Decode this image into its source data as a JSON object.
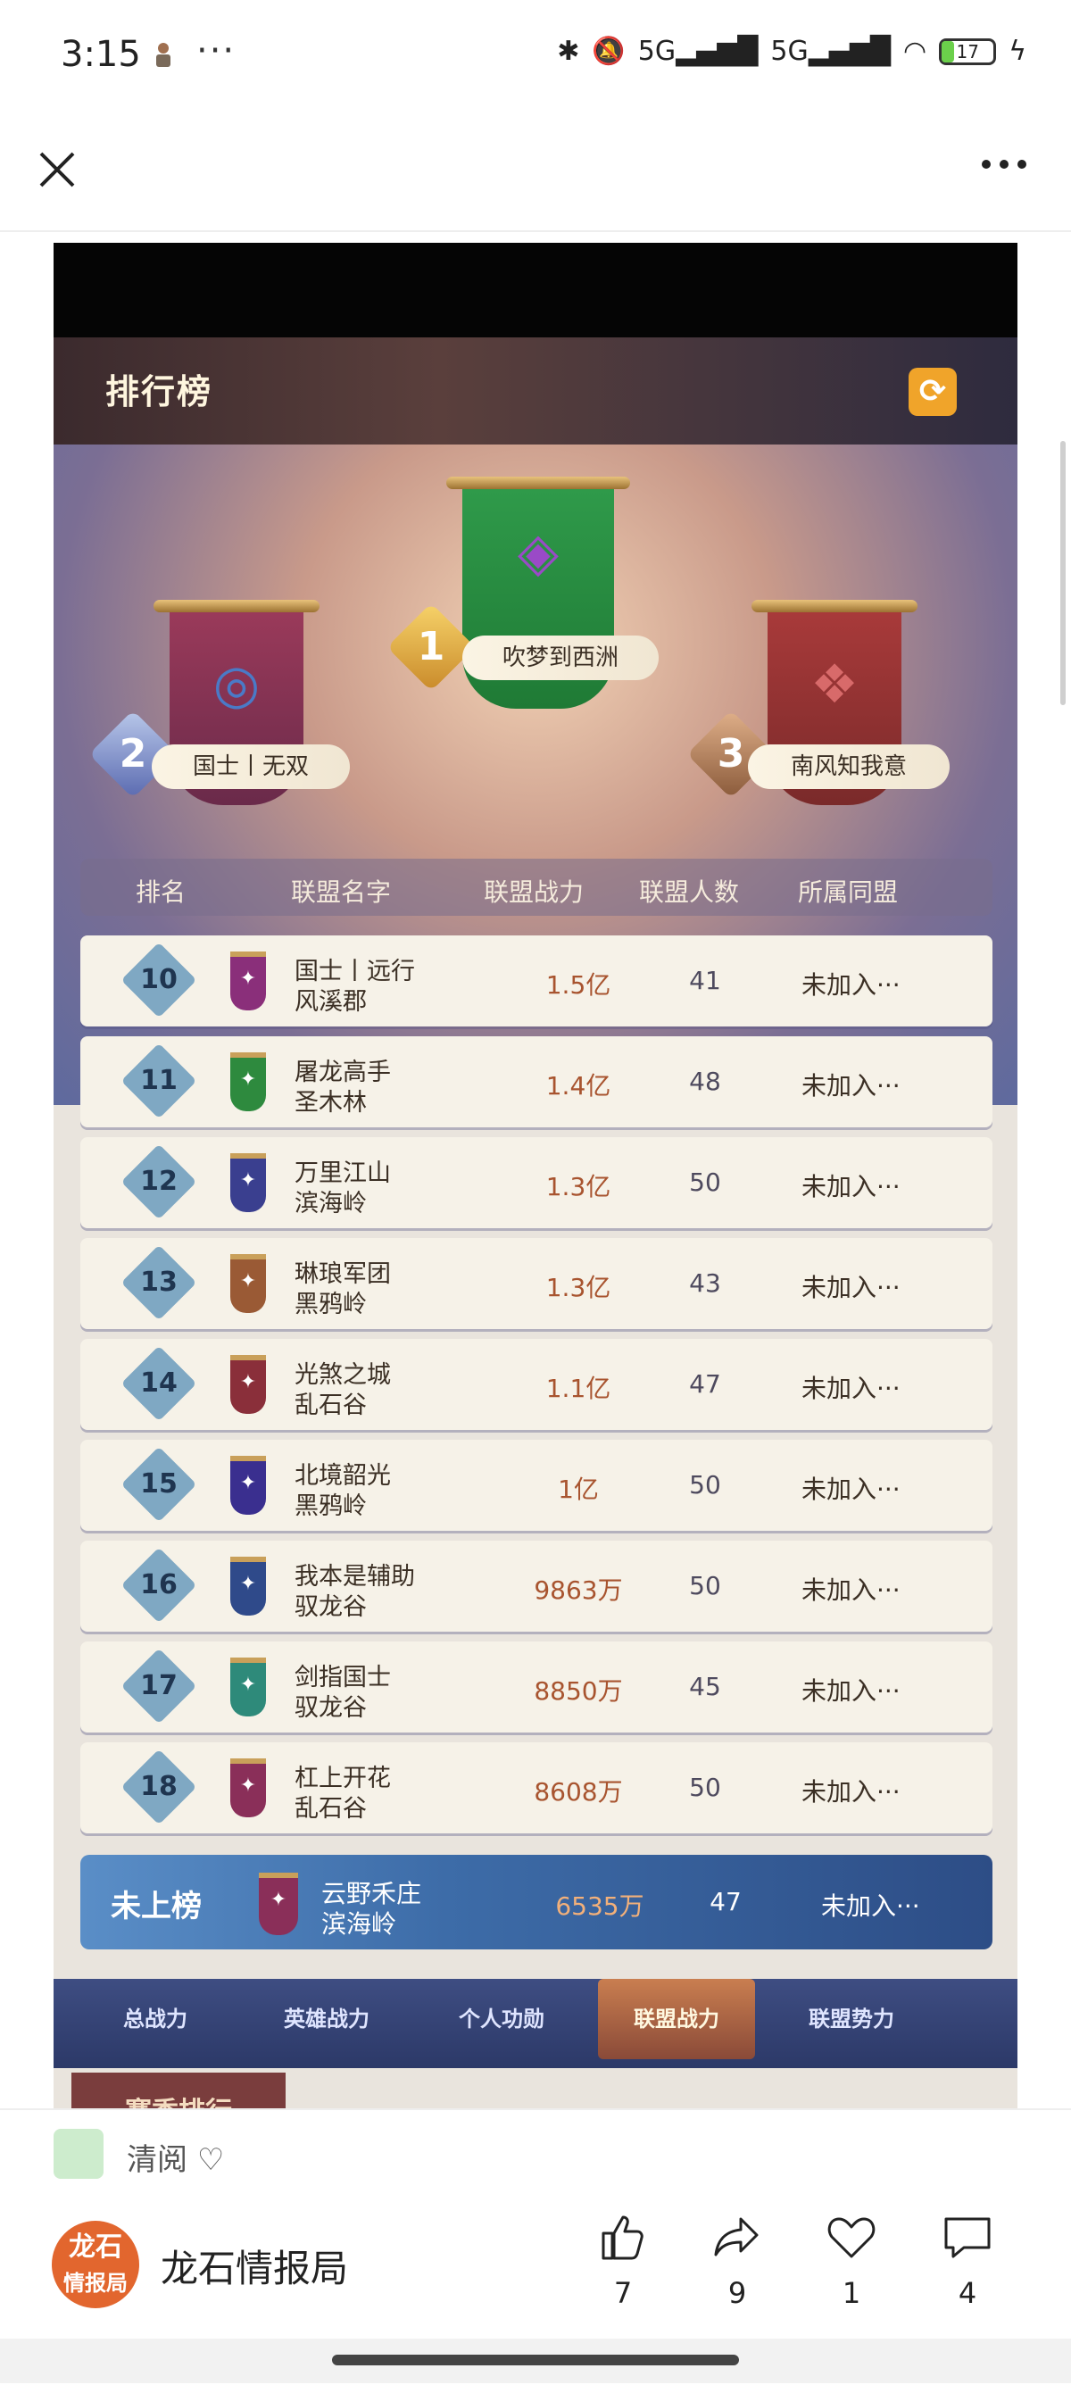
{
  "status": {
    "time": "3:15",
    "dots": "···",
    "network1": "5G",
    "network2": "5G",
    "battery": "17"
  },
  "game": {
    "title": "排行榜",
    "podium": [
      {
        "rank": "1",
        "name": "吹梦到西洲"
      },
      {
        "rank": "2",
        "name": "国士丨无双"
      },
      {
        "rank": "3",
        "name": "南风知我意"
      }
    ],
    "columns": [
      "排名",
      "联盟名字",
      "联盟战力",
      "联盟人数",
      "所属同盟"
    ],
    "rows": [
      {
        "rank": "10",
        "name": "国士丨远行",
        "region": "风溪郡",
        "power": "1.5亿",
        "members": "41",
        "alliance": "未加入···",
        "flag_color": "#8a2f7a"
      },
      {
        "rank": "11",
        "name": "屠龙高手",
        "region": "圣木林",
        "power": "1.4亿",
        "members": "48",
        "alliance": "未加入···",
        "flag_color": "#2e8a3e"
      },
      {
        "rank": "12",
        "name": "万里江山",
        "region": "滨海岭",
        "power": "1.3亿",
        "members": "50",
        "alliance": "未加入···",
        "flag_color": "#3a3f8f"
      },
      {
        "rank": "13",
        "name": "琳琅军团",
        "region": "黑鸦岭",
        "power": "1.3亿",
        "members": "43",
        "alliance": "未加入···",
        "flag_color": "#9a5a35"
      },
      {
        "rank": "14",
        "name": "光煞之城",
        "region": "乱石谷",
        "power": "1.1亿",
        "members": "47",
        "alliance": "未加入···",
        "flag_color": "#8a2f3a"
      },
      {
        "rank": "15",
        "name": "北境韶光",
        "region": "黑鸦岭",
        "power": "1亿",
        "members": "50",
        "alliance": "未加入···",
        "flag_color": "#3a2f8f"
      },
      {
        "rank": "16",
        "name": "我本是辅助",
        "region": "驭龙谷",
        "power": "9863万",
        "members": "50",
        "alliance": "未加入···",
        "flag_color": "#2f4a8a"
      },
      {
        "rank": "17",
        "name": "剑指国士",
        "region": "驭龙谷",
        "power": "8850万",
        "members": "45",
        "alliance": "未加入···",
        "flag_color": "#2e8a7a"
      },
      {
        "rank": "18",
        "name": "杠上开花",
        "region": "乱石谷",
        "power": "8608万",
        "members": "50",
        "alliance": "未加入···",
        "flag_color": "#8a2f59"
      }
    ],
    "self": {
      "label": "未上榜",
      "name": "云野禾庄",
      "region": "滨海岭",
      "power": "6535万",
      "members": "47",
      "alliance": "未加入···"
    },
    "tabs": [
      "总战力",
      "英雄战力",
      "个人功勋",
      "联盟战力",
      "联盟势力"
    ],
    "active_tab": "联盟战力",
    "season_label": "赛季排行"
  },
  "footer": {
    "topic": "清阅",
    "author": "龙石情报局",
    "avatar_line1": "龙石",
    "avatar_line2": "情报局",
    "likes": "7",
    "shares": "9",
    "favorites": "1",
    "comments": "4"
  },
  "colors": {
    "accent": "#f0a42a",
    "row_bg": "#f6f2e8",
    "power_text": "#a8542f"
  }
}
